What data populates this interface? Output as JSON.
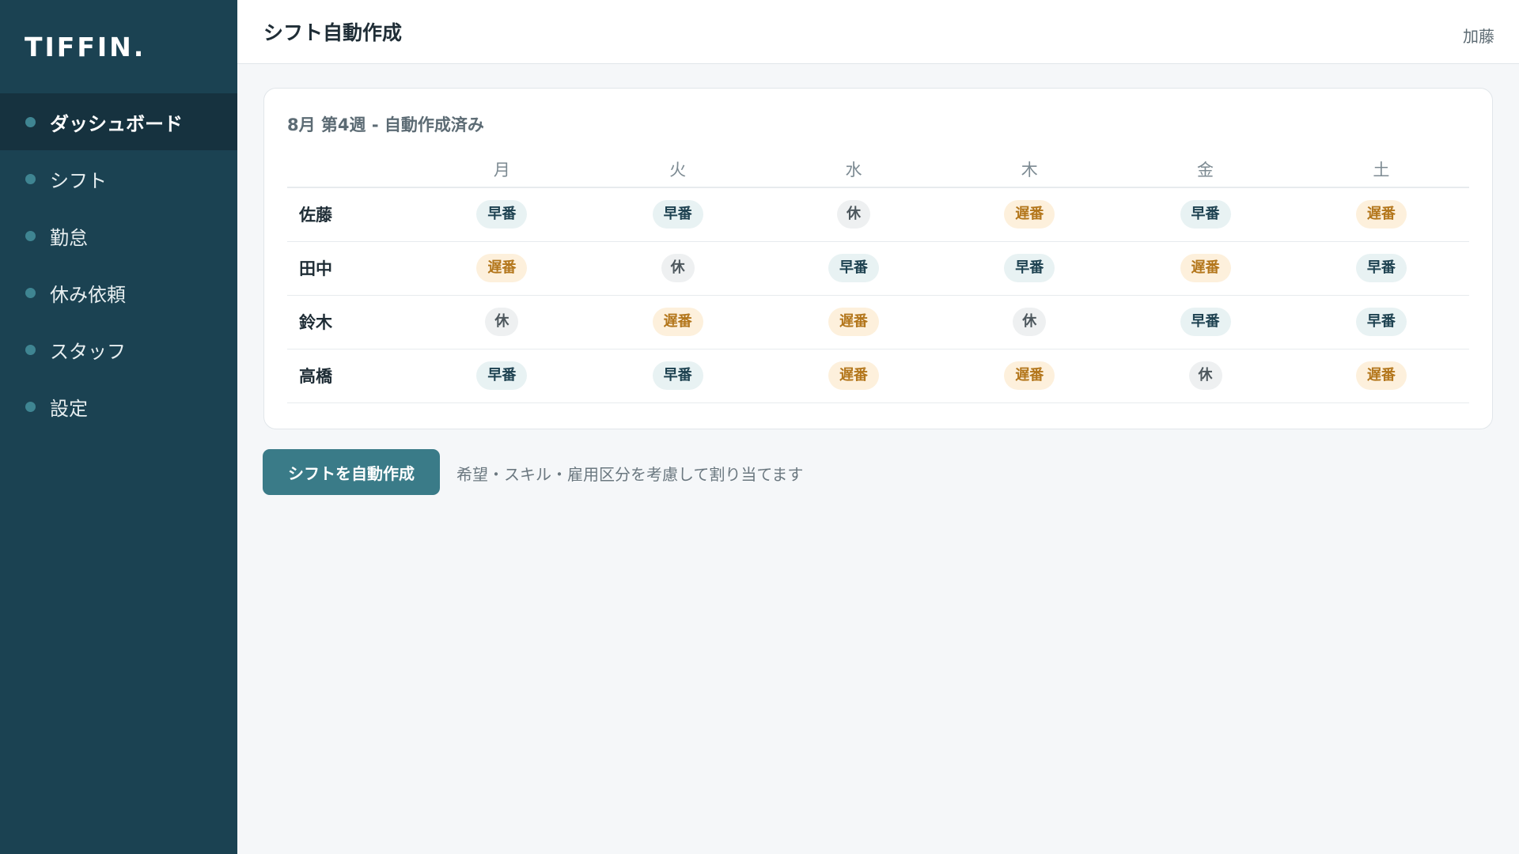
{
  "app": {
    "logo": "TIFFIN."
  },
  "sidebar": {
    "items": [
      {
        "label": "ダッシュボード",
        "active": true
      },
      {
        "label": "シフト",
        "active": false
      },
      {
        "label": "勤怠",
        "active": false
      },
      {
        "label": "休み依頼",
        "active": false
      },
      {
        "label": "スタッフ",
        "active": false
      },
      {
        "label": "設定",
        "active": false
      }
    ]
  },
  "header": {
    "title": "シフト自動作成",
    "user": "加藤"
  },
  "schedule": {
    "title": "8月 第4週 - 自動作成済み",
    "days": [
      "月",
      "火",
      "水",
      "木",
      "金",
      "土"
    ],
    "rows": [
      {
        "name": "佐藤",
        "shifts": [
          "早番",
          "早番",
          "休",
          "遅番",
          "早番",
          "遅番"
        ]
      },
      {
        "name": "田中",
        "shifts": [
          "遅番",
          "休",
          "早番",
          "早番",
          "遅番",
          "早番"
        ]
      },
      {
        "name": "鈴木",
        "shifts": [
          "休",
          "遅番",
          "遅番",
          "休",
          "早番",
          "早番"
        ]
      },
      {
        "name": "高橋",
        "shifts": [
          "早番",
          "早番",
          "遅番",
          "遅番",
          "休",
          "遅番"
        ]
      }
    ]
  },
  "actions": {
    "auto_button": "シフトを自動作成",
    "hint": "希望・スキル・雇用区分を考慮して割り当てます"
  },
  "colors": {
    "sidebar": "#1b4252",
    "accent": "#3a7b88",
    "early_bg": "#e8f2f3",
    "late_bg": "#fdf0dc",
    "late_text": "#b3761b"
  }
}
